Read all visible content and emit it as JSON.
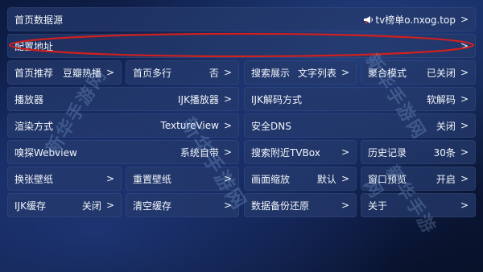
{
  "rows": {
    "source": {
      "label": "首页数据源",
      "value": "tv榜单o.nxog.top",
      "icon": "megaphone-icon",
      "arrow": ">"
    },
    "config": {
      "label": "配置地址",
      "arrow": ">"
    }
  },
  "grid": [
    [
      {
        "label": "首页推荐",
        "value": "豆瓣热播",
        "arrow": ">"
      },
      {
        "label": "首页多行",
        "value": "否",
        "arrow": ">"
      },
      {
        "label": "搜索展示",
        "value": "文字列表",
        "arrow": ">"
      },
      {
        "label": "聚合模式",
        "value": "已关闭",
        "arrow": ">"
      }
    ],
    [
      {
        "label": "播放器",
        "value": "IJK播放器",
        "arrow": ">"
      },
      {
        "label": "IJK解码方式",
        "value": "软解码",
        "arrow": ">"
      }
    ],
    [
      {
        "label": "渲染方式",
        "value": "TextureView",
        "arrow": ">"
      },
      {
        "label": "安全DNS",
        "value": "关闭",
        "arrow": ">"
      }
    ],
    [
      {
        "label": "嗅探Webview",
        "value": "系统自带",
        "arrow": ">"
      },
      {
        "label": "搜索附近TVBox",
        "arrow": ">"
      },
      {
        "label": "历史记录",
        "value": "30条",
        "arrow": ">"
      }
    ],
    [
      {
        "label": "换张壁纸",
        "arrow": ">"
      },
      {
        "label": "重置壁纸",
        "arrow": ">"
      },
      {
        "label": "画面缩放",
        "value": "默认",
        "arrow": ">"
      },
      {
        "label": "窗口预览",
        "value": "开启",
        "arrow": ">"
      }
    ],
    [
      {
        "label": "IJK缓存",
        "value": "关闭",
        "arrow": ">"
      },
      {
        "label": "清空缓存",
        "arrow": ">"
      },
      {
        "label": "数据备份还原",
        "arrow": ">"
      },
      {
        "label": "关于",
        "arrow": ">"
      }
    ]
  ],
  "watermark": {
    "text": "新华手游网"
  },
  "colors": {
    "highlight": "#d0201e",
    "tile": "#263a6c",
    "text": "#f2f5fa"
  }
}
